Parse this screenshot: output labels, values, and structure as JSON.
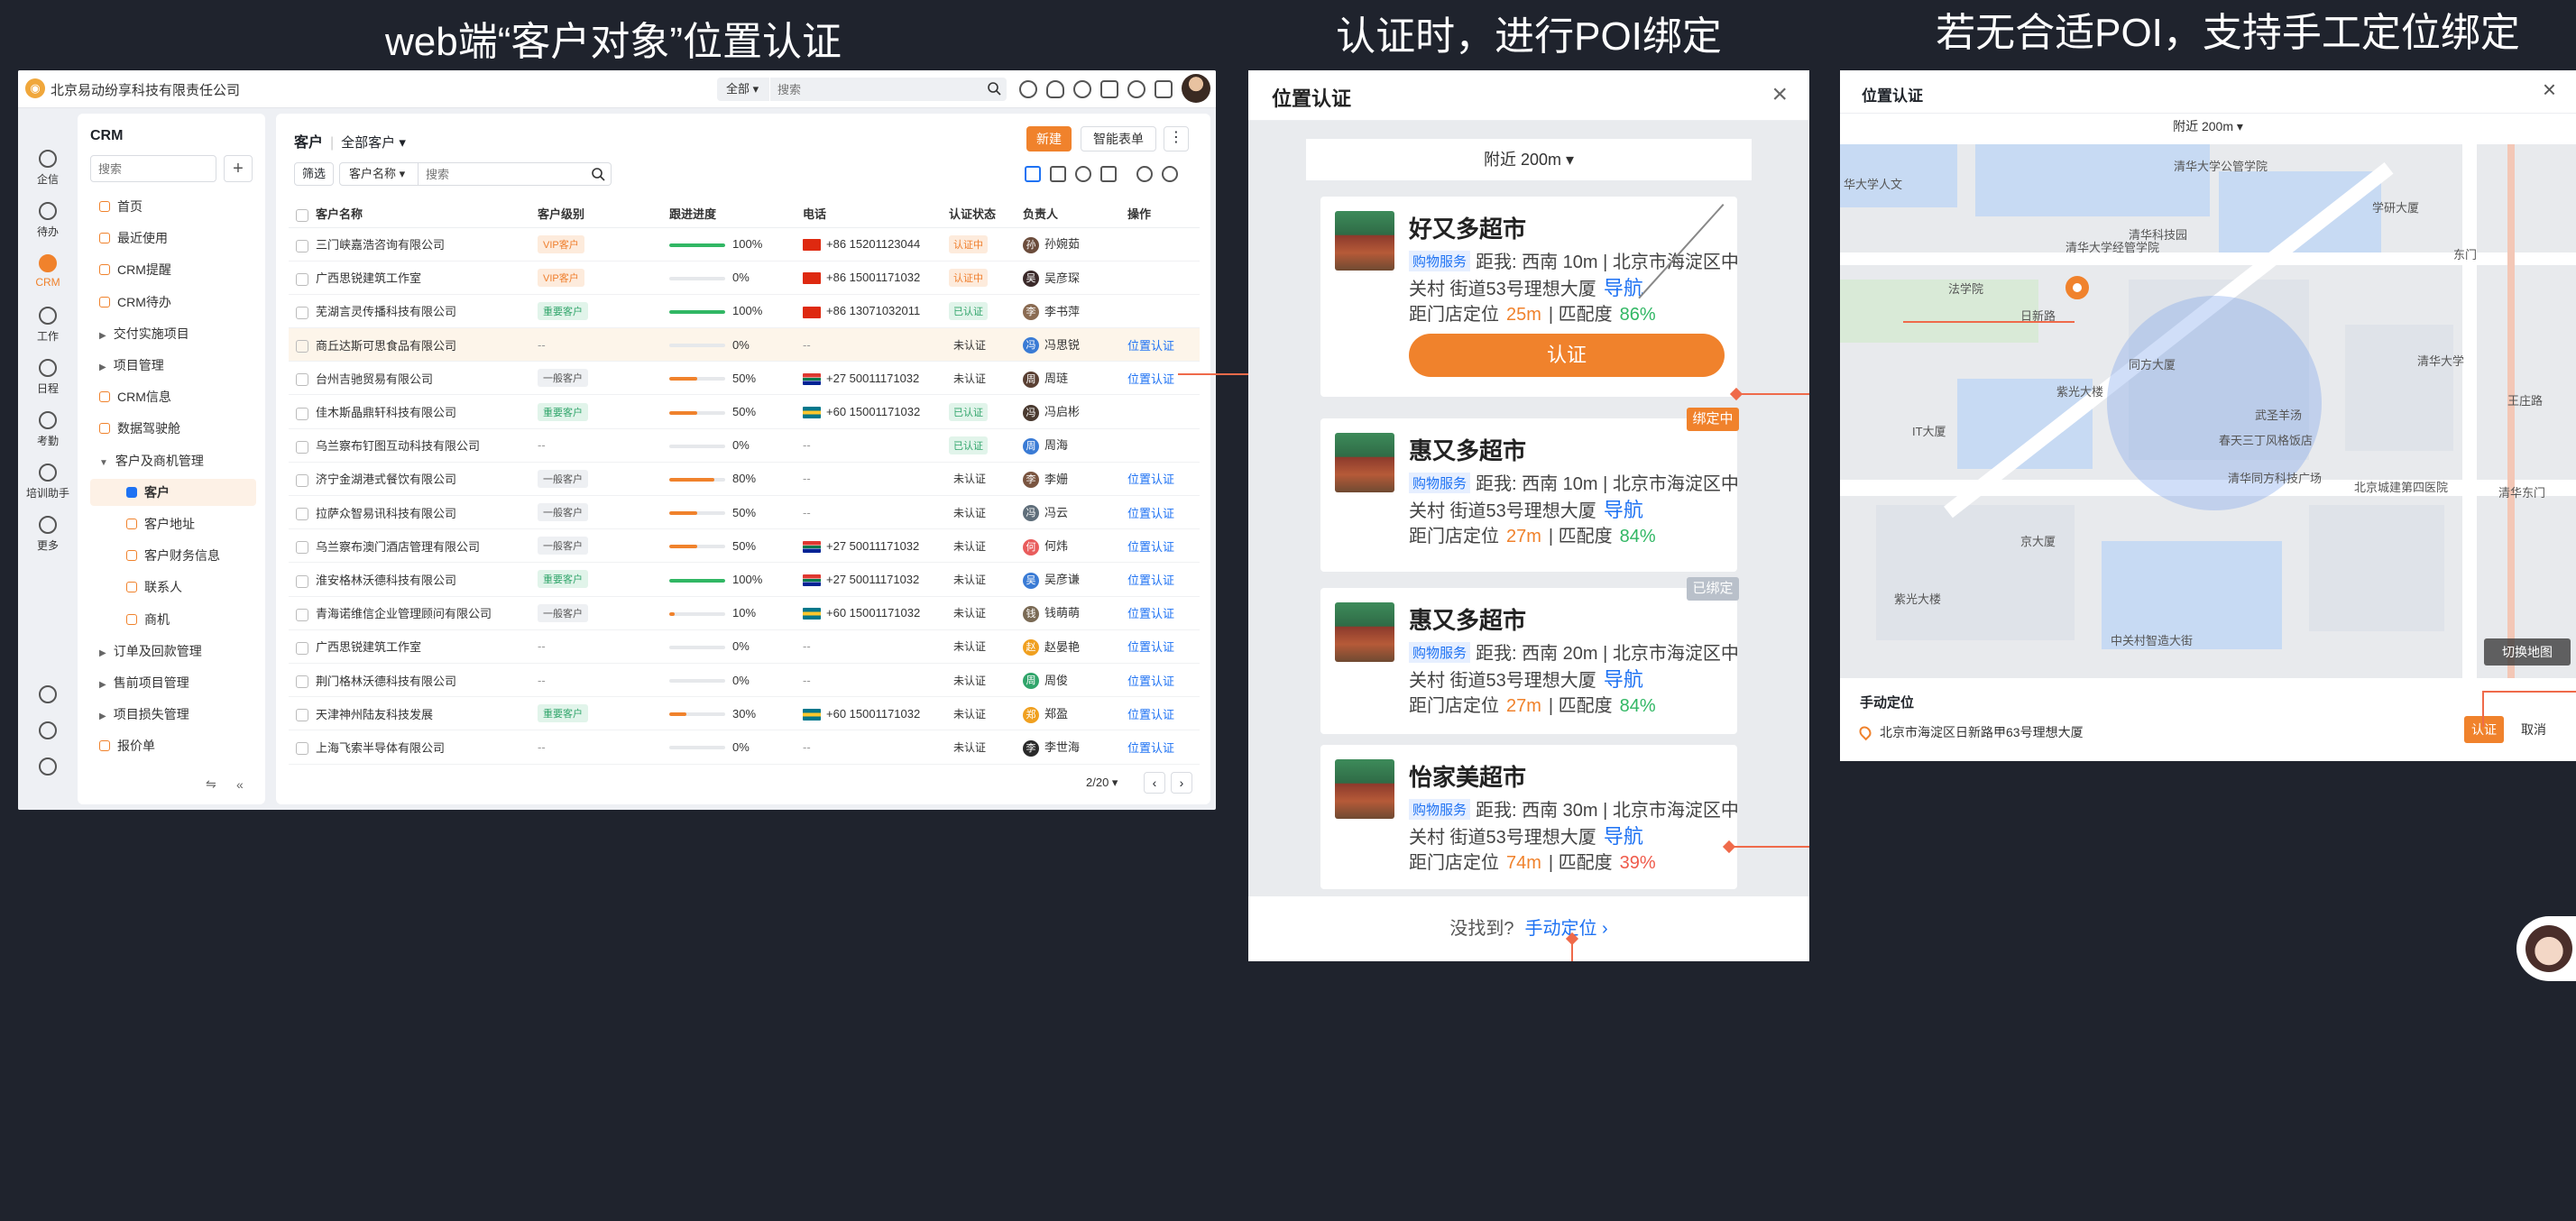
{
  "captions": {
    "web": "web端“客户对象”位置认证",
    "poi": "认证时，进行POI绑定",
    "manual": "若无合适POI，支持手工定位绑定"
  },
  "crm": {
    "company": "北京易动纷享科技有限责任公司",
    "scope": "全部",
    "search_placeholder": "搜索",
    "rail": [
      {
        "label": "企信",
        "icon": "chat-icon"
      },
      {
        "label": "待办",
        "icon": "check-icon"
      },
      {
        "label": "CRM",
        "icon": "pie-chart-icon",
        "active": true
      },
      {
        "label": "工作",
        "icon": "briefcase-icon"
      },
      {
        "label": "日程",
        "icon": "calendar-icon"
      },
      {
        "label": "考勤",
        "icon": "location-icon"
      },
      {
        "label": "培训助手",
        "icon": "book-icon"
      },
      {
        "label": "更多",
        "icon": "grid-icon"
      }
    ],
    "nav": {
      "title": "CRM",
      "search_placeholder": "搜索",
      "items": [
        {
          "label": "首页",
          "type": "top"
        },
        {
          "label": "最近使用",
          "type": "top"
        },
        {
          "label": "CRM提醒",
          "type": "top"
        },
        {
          "label": "CRM待办",
          "type": "top"
        },
        {
          "label": "交付实施项目",
          "type": "group"
        },
        {
          "label": "项目管理",
          "type": "group"
        },
        {
          "label": "CRM信息",
          "type": "top"
        },
        {
          "label": "数据驾驶舱",
          "type": "top"
        },
        {
          "label": "客户及商机管理",
          "type": "open"
        },
        {
          "label": "客户",
          "type": "sub",
          "active": true
        },
        {
          "label": "客户地址",
          "type": "sub"
        },
        {
          "label": "客户财务信息",
          "type": "sub"
        },
        {
          "label": "联系人",
          "type": "sub"
        },
        {
          "label": "商机",
          "type": "sub"
        },
        {
          "label": "订单及回款管理",
          "type": "group"
        },
        {
          "label": "售前项目管理",
          "type": "group"
        },
        {
          "label": "项目损失管理",
          "type": "group"
        },
        {
          "label": "报价单",
          "type": "top"
        }
      ]
    },
    "main": {
      "object": "客户",
      "view": "全部客户",
      "new_label": "新建",
      "smart_label": "智能表单",
      "more_label": "⋮",
      "filter_label": "筛选",
      "field_label": "客户名称",
      "search_placeholder": "搜索",
      "columns": [
        "客户名称",
        "客户级别",
        "跟进进度",
        "电话",
        "认证状态",
        "负责人",
        "操作"
      ],
      "rows": [
        {
          "name": "三门峡嘉浩咨询有限公司",
          "level": "VIP客户",
          "lv": "vip",
          "progress": 100,
          "pct": "100%",
          "flag": "cn",
          "phone": "+86 15201123044",
          "status": "认证中",
          "st": "ing",
          "owner": "孙婉茹",
          "action": ""
        },
        {
          "name": "广西思锐建筑工作室",
          "level": "VIP客户",
          "lv": "vip",
          "progress": 0,
          "pct": "0%",
          "flag": "cn",
          "phone": "+86 15001171032",
          "status": "认证中",
          "st": "ing",
          "owner": "吴彦琛",
          "action": ""
        },
        {
          "name": "芜湖言灵传播科技有限公司",
          "level": "重要客户",
          "lv": "key",
          "progress": 100,
          "pct": "100%",
          "flag": "cn",
          "phone": "+86 13071032011",
          "status": "已认证",
          "st": "ok",
          "owner": "李书萍",
          "action": ""
        },
        {
          "name": "商丘达斯可思食品有限公司",
          "level": "--",
          "lv": "",
          "progress": 0,
          "pct": "0%",
          "flag": "",
          "phone": "--",
          "status": "未认证",
          "st": "no",
          "owner": "冯思锐",
          "action": "位置认证",
          "highlight": true
        },
        {
          "name": "台州吉驰贸易有限公司",
          "level": "一般客户",
          "lv": "gen",
          "progress": 50,
          "pct": "50%",
          "flag": "za",
          "phone": "+27 50011171032",
          "status": "未认证",
          "st": "no",
          "owner": "周琏",
          "action": "位置认证"
        },
        {
          "name": "佳木斯晶鼎轩科技有限公司",
          "level": "重要客户",
          "lv": "key",
          "progress": 50,
          "pct": "50%",
          "flag": "bs",
          "phone": "+60 15001171032",
          "status": "已认证",
          "st": "ok",
          "owner": "冯启彬",
          "action": ""
        },
        {
          "name": "乌兰察布钉图互动科技有限公司",
          "level": "--",
          "lv": "",
          "progress": 0,
          "pct": "0%",
          "flag": "",
          "phone": "--",
          "status": "已认证",
          "st": "ok",
          "owner": "周海",
          "action": ""
        },
        {
          "name": "济宁金湖港式餐饮有限公司",
          "level": "一般客户",
          "lv": "gen",
          "progress": 80,
          "pct": "80%",
          "flag": "",
          "phone": "--",
          "status": "未认证",
          "st": "no",
          "owner": "李姗",
          "action": "位置认证"
        },
        {
          "name": "拉萨众智易讯科技有限公司",
          "level": "一般客户",
          "lv": "gen",
          "progress": 50,
          "pct": "50%",
          "flag": "",
          "phone": "--",
          "status": "未认证",
          "st": "no",
          "owner": "冯云",
          "action": "位置认证"
        },
        {
          "name": "乌兰察布澳门酒店管理有限公司",
          "level": "一般客户",
          "lv": "gen",
          "progress": 50,
          "pct": "50%",
          "flag": "za",
          "phone": "+27 50011171032",
          "status": "未认证",
          "st": "no",
          "owner": "何炜",
          "action": "位置认证"
        },
        {
          "name": "淮安格林沃德科技有限公司",
          "level": "重要客户",
          "lv": "key",
          "progress": 100,
          "pct": "100%",
          "flag": "za",
          "phone": "+27 50011171032",
          "status": "未认证",
          "st": "no",
          "owner": "吴彦谦",
          "action": "位置认证"
        },
        {
          "name": "青海诺维信企业管理顾问有限公司",
          "level": "一般客户",
          "lv": "gen",
          "progress": 10,
          "pct": "10%",
          "flag": "bs",
          "phone": "+60 15001171032",
          "status": "未认证",
          "st": "no",
          "owner": "钱萌萌",
          "action": "位置认证"
        },
        {
          "name": "广西思锐建筑工作室",
          "level": "--",
          "lv": "",
          "progress": 0,
          "pct": "0%",
          "flag": "",
          "phone": "--",
          "status": "未认证",
          "st": "no",
          "owner": "赵晏艳",
          "action": "位置认证"
        },
        {
          "name": "荆门格林沃德科技有限公司",
          "level": "--",
          "lv": "",
          "progress": 0,
          "pct": "0%",
          "flag": "",
          "phone": "--",
          "status": "未认证",
          "st": "no",
          "owner": "周俊",
          "action": "位置认证"
        },
        {
          "name": "天津神州陆友科技发展",
          "level": "重要客户",
          "lv": "key",
          "progress": 30,
          "pct": "30%",
          "flag": "bs",
          "phone": "+60 15001171032",
          "status": "未认证",
          "st": "no",
          "owner": "郑盈",
          "action": "位置认证"
        },
        {
          "name": "上海飞索半导体有限公司",
          "level": "--",
          "lv": "",
          "progress": 0,
          "pct": "0%",
          "flag": "",
          "phone": "--",
          "status": "未认证",
          "st": "no",
          "owner": "李世海",
          "action": "位置认证"
        }
      ],
      "pager": "2/20"
    }
  },
  "poi_panel": {
    "title": "位置认证",
    "range": "附近 200m ▾",
    "items": [
      {
        "name": "好又多超市",
        "cat": "购物服务",
        "dist": "距我: 西南 10m | 北京市海淀区中",
        "addr": "关村 街道53号理想大厦",
        "nav": "导航",
        "loc_prefix": "距门店定位",
        "loc": "25m",
        "match_prefix": "| 匹配度",
        "match": "86%",
        "mc": "grn",
        "button": "认证",
        "ribbon": ""
      },
      {
        "name": "惠又多超市",
        "cat": "购物服务",
        "dist": "距我: 西南 10m | 北京市海淀区中",
        "addr": "关村 街道53号理想大厦",
        "nav": "导航",
        "loc_prefix": "距门店定位",
        "loc": "27m",
        "match_prefix": "| 匹配度",
        "match": "84%",
        "mc": "grn",
        "button": "",
        "ribbon": "绑定中"
      },
      {
        "name": "惠又多超市",
        "cat": "购物服务",
        "dist": "距我: 西南 20m | 北京市海淀区中",
        "addr": "关村 街道53号理想大厦",
        "nav": "导航",
        "loc_prefix": "距门店定位",
        "loc": "27m",
        "match_prefix": "| 匹配度",
        "match": "84%",
        "mc": "grn",
        "button": "",
        "ribbon": "已绑定"
      },
      {
        "name": "怡家美超市",
        "cat": "购物服务",
        "dist": "距我: 西南 30m | 北京市海淀区中",
        "addr": "关村 街道53号理想大厦",
        "nav": "导航",
        "loc_prefix": "距门店定位",
        "loc": "74m",
        "match_prefix": "| 匹配度",
        "match": "39%",
        "mc": "red",
        "button": "",
        "ribbon": ""
      }
    ],
    "not_found": "没找到?",
    "manual": "手动定位 ›"
  },
  "manual_panel": {
    "title": "位置认证",
    "range": "附近 200m ▾",
    "map_labels": [
      "清华大学公管学院",
      "学研大厦",
      "华大学人文",
      "清华科技园",
      "清华大学经管学院",
      "法学院",
      "东门",
      "日新路",
      "同方大厦",
      "武圣羊汤",
      "清华大学",
      "紫光大楼",
      "王庄路",
      "IT大厦",
      "清华同方科技广场",
      "北京城建第四医院",
      "春天三丁风格饭店",
      "京大厦",
      "中关村智造大街",
      "紫光大楼",
      "清华东门"
    ],
    "switch_map": "切换地图",
    "manual_label": "手动定位",
    "address": "北京市海淀区日新路甲63号理想大厦",
    "confirm": "认证",
    "cancel": "取消"
  }
}
